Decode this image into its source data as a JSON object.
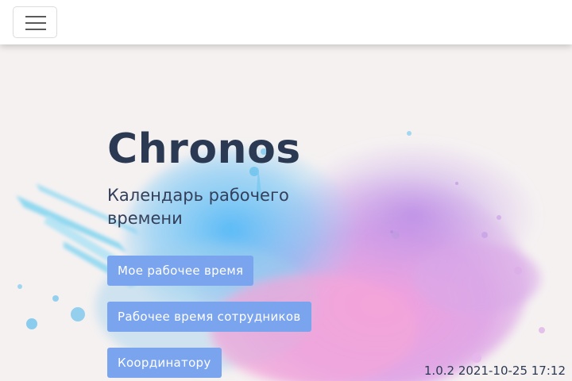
{
  "navbar": {
    "toggle_icon": "hamburger-menu-icon"
  },
  "hero": {
    "title": "Chronos",
    "subtitle": "Календарь рабочего времени"
  },
  "actions": {
    "my_time": "Мое рабочее время",
    "staff_time": "Рабочее время сотрудников",
    "coordinator": "Координатору"
  },
  "footer": {
    "version": "1.0.2 2021-10-25 17:12"
  },
  "colors": {
    "background": "#f5f1f1",
    "title": "#2b3a52",
    "button": "#7ba4ef",
    "navbar": "#ffffff"
  }
}
